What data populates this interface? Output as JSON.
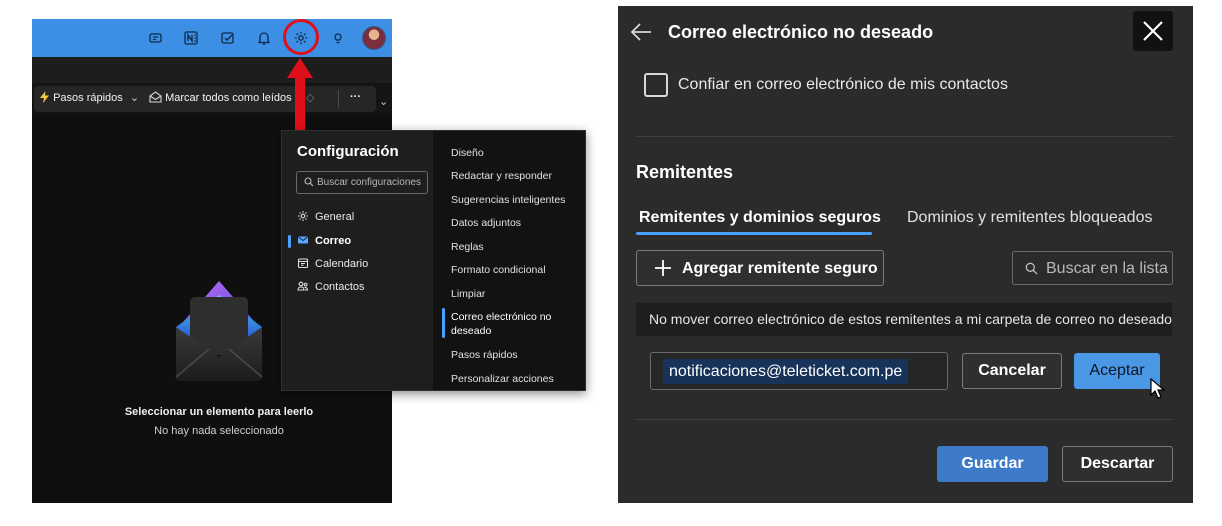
{
  "left": {
    "topbar": {
      "icons": [
        "team-icon",
        "onenote-icon",
        "todo-icon",
        "bell-icon",
        "gear-icon",
        "lightbulb-icon"
      ],
      "accent": "#3d8fe5"
    },
    "toolbar": {
      "quick_steps": "Pasos rápidos",
      "mark_all_read": "Marcar todos como leídos",
      "more": "···"
    },
    "empty_state": {
      "title": "Seleccionar un elemento para leerlo",
      "subtitle": "No hay nada seleccionado"
    },
    "settings": {
      "title": "Configuración",
      "search_placeholder": "Buscar configuraciones",
      "nav": [
        "General",
        "Correo",
        "Calendario",
        "Contactos"
      ],
      "active_nav": "Correo",
      "subnav": [
        "Diseño",
        "Redactar y responder",
        "Sugerencias inteligentes",
        "Datos adjuntos",
        "Reglas",
        "Formato condicional",
        "Limpiar",
        "Correo electrónico no deseado",
        "Pasos rápidos",
        "Personalizar acciones"
      ],
      "active_subnav": "Correo electrónico no deseado"
    }
  },
  "right": {
    "title": "Correo electrónico no deseado",
    "trust_contacts_label": "Confiar en correo electrónico de mis contactos",
    "section_title": "Remitentes",
    "tabs": [
      "Remitentes y dominios seguros",
      "Dominios y remitentes bloqueados"
    ],
    "add_safe_sender": "Agregar remitente seguro",
    "search_placeholder": "Buscar en la lista",
    "info_text": "No mover correo electrónico de estos remitentes a mi carpeta de correo no deseado.",
    "email_value": "notificaciones@teleticket.com.pe",
    "cancel": "Cancelar",
    "accept": "Aceptar",
    "save": "Guardar",
    "discard": "Descartar",
    "accent": "#4aa0ff"
  }
}
